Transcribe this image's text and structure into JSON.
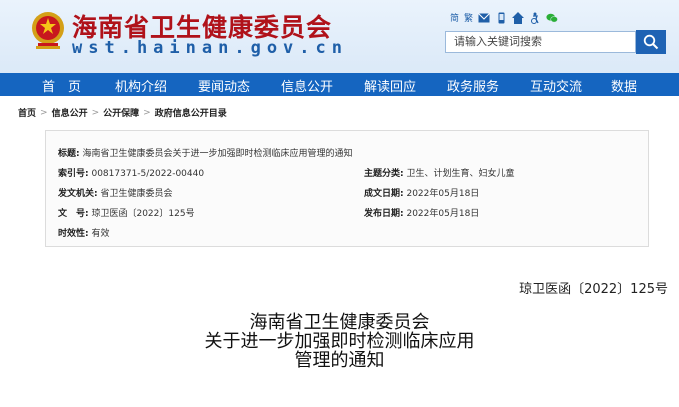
{
  "header": {
    "site_title": "海南省卫生健康委员会",
    "site_url": "wst.hainan.gov.cn",
    "tools": {
      "simplified": "简",
      "traditional": "繁"
    },
    "search_placeholder": "请输入关键词搜索",
    "brand_color": "#b0121a",
    "accent_color": "#1565c0"
  },
  "nav": [
    "首　页",
    "机构介绍",
    "要闻动态",
    "信息公开",
    "解读回应",
    "政务服务",
    "互动交流",
    "数据"
  ],
  "breadcrumb": [
    "首页",
    "信息公开",
    "公开保障",
    "政府信息公开目录"
  ],
  "info": {
    "title_label": "标题:",
    "title_value": "海南省卫生健康委员会关于进一步加强即时检测临床应用管理的通知",
    "index_label": "索引号:",
    "index_value": "00817371-5/2022-00440",
    "topic_label": "主题分类:",
    "topic_value": "卫生、计划生育、妇女儿童",
    "issuer_label": "发文机关:",
    "issuer_value": "省卫生健康委员会",
    "created_label": "成文日期:",
    "created_value": "2022年05月18日",
    "docno_label": "文　号:",
    "docno_value": "琼卫医函〔2022〕125号",
    "published_label": "发布日期:",
    "published_value": "2022年05月18日",
    "validity_label": "时效性:",
    "validity_value": "有效"
  },
  "document": {
    "number": "琼卫医函〔2022〕125号",
    "title_lines": [
      "海南省卫生健康委员会",
      "关于进一步加强即时检测临床应用",
      "管理的通知"
    ]
  }
}
